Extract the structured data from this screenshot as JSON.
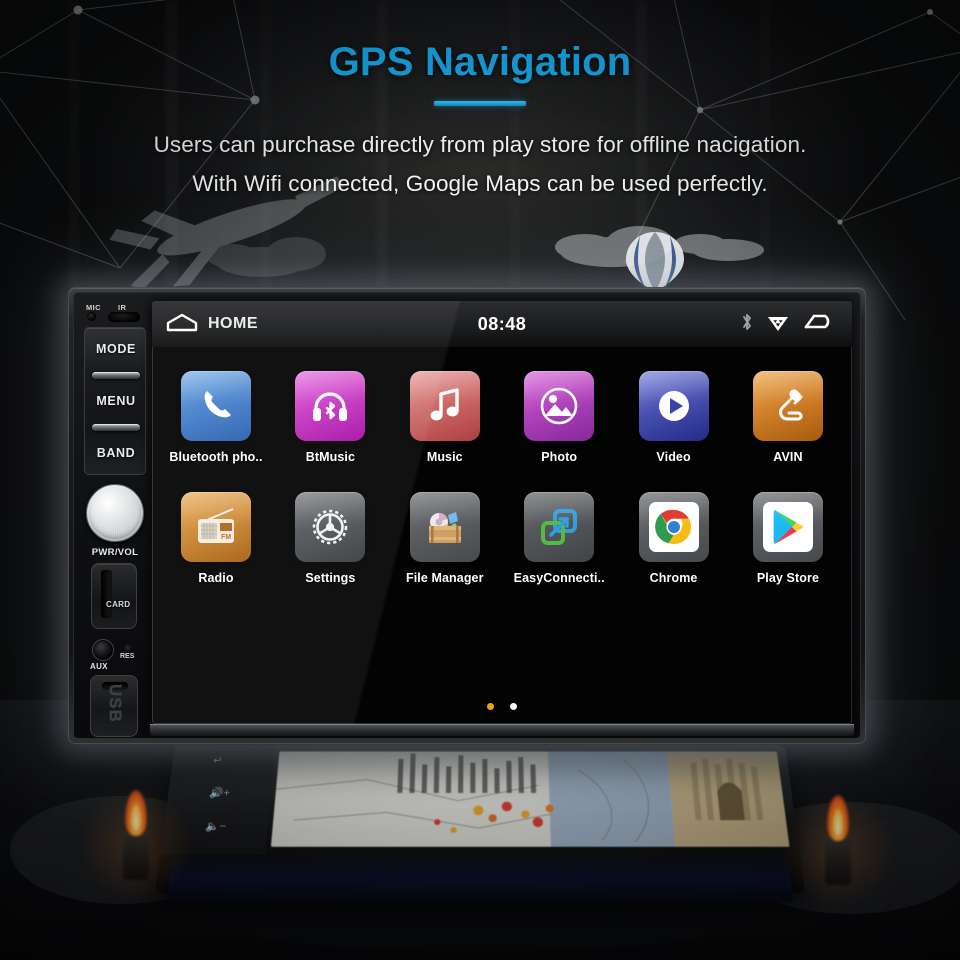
{
  "header": {
    "title": "GPS Navigation",
    "subtitle_1": "Users can purchase directly from play store for offline nacigation.",
    "subtitle_2": "With Wifi connected, Google Maps can be used perfectly.",
    "accent_color": "#17A7E8",
    "underline_color": "#2BB4EE"
  },
  "device": {
    "control_panel": {
      "mic_label": "MIC",
      "ir_label": "IR",
      "buttons": [
        {
          "label": "MODE"
        },
        {
          "label": "MENU"
        },
        {
          "label": "BAND"
        }
      ],
      "knob_label": "PWR/VOL",
      "card_label": "CARD",
      "aux_label": "AUX",
      "res_label": "RES",
      "usb_label": "USB"
    },
    "status_bar": {
      "home_icon": "home-icon",
      "home_label": "HOME",
      "clock": "08:48",
      "bluetooth_icon": "bluetooth-icon",
      "wifi_icon": "wifi-signal-icon",
      "back_icon": "back-arrow-icon"
    },
    "home_screen": {
      "rows": [
        [
          {
            "label": "Bluetooth pho..",
            "icon": "phone-icon",
            "c1": "#7fb3e8",
            "c2": "#2f69b8"
          },
          {
            "label": "BtMusic",
            "icon": "bt-headset-icon",
            "c1": "#e06fd8",
            "c2": "#b21bb0"
          },
          {
            "label": "Music",
            "icon": "music-note-icon",
            "c1": "#e39191",
            "c2": "#b84a49"
          },
          {
            "label": "Photo",
            "icon": "photo-icon",
            "c1": "#d468d8",
            "c2": "#8f2fa8"
          },
          {
            "label": "Video",
            "icon": "play-icon",
            "c1": "#7b86d8",
            "c2": "#2b2f8e"
          },
          {
            "label": "AVIN",
            "icon": "plug-cable-icon",
            "c1": "#e9a552",
            "c2": "#b5610f"
          }
        ],
        [
          {
            "label": "Radio",
            "icon": "radio-icon",
            "c1": "#e2a355",
            "c2": "#b46a18"
          },
          {
            "label": "Settings",
            "icon": "gear-icon",
            "c1": "#6d7073",
            "c2": "#3b3e41"
          },
          {
            "label": "File Manager",
            "icon": "file-crate-icon",
            "c1": "#6a6d70",
            "c2": "#4a4d50"
          },
          {
            "label": "EasyConnecti..",
            "icon": "easyconnect-icon",
            "c1": "#66696c",
            "c2": "#45484b"
          },
          {
            "label": "Chrome",
            "icon": "chrome-icon",
            "c1": "#6a6d70",
            "c2": "#4a4d50"
          },
          {
            "label": "Play Store",
            "icon": "play-store-icon",
            "c1": "#6a6d70",
            "c2": "#4a4d50"
          }
        ]
      ],
      "page_dots": [
        {
          "name": "page-dot-active",
          "color": "#F5A30B"
        },
        {
          "name": "page-dot-inactive",
          "color": "#FFFFFF"
        }
      ]
    }
  },
  "background_device": {
    "back_icon": "back-arrow-icon",
    "volume_up_icon": "volume-up-icon",
    "volume_down_icon": "volume-down-icon"
  }
}
